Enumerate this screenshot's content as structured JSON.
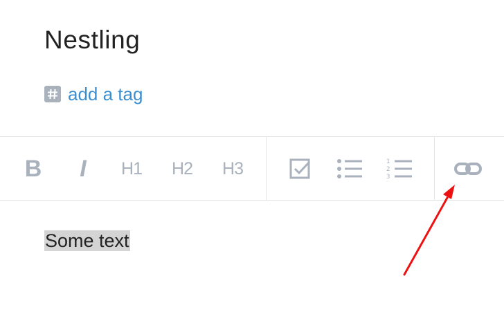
{
  "note": {
    "title": "Nestling",
    "add_tag_label": "add a tag"
  },
  "toolbar": {
    "bold_label": "B",
    "italic_label": "I",
    "h1_label": "H1",
    "h2_label": "H2",
    "h3_label": "H3"
  },
  "editor": {
    "content": "Some text"
  },
  "colors": {
    "icon": "#a9b2bc",
    "link": "#3b8ed0",
    "annotation_arrow": "#ee1111",
    "selection": "#d4d4d4"
  },
  "icons": [
    "hash-icon",
    "bold-icon",
    "italic-icon",
    "h1-icon",
    "h2-icon",
    "h3-icon",
    "checkbox-icon",
    "bullet-list-icon",
    "numbered-list-icon",
    "link-icon"
  ]
}
